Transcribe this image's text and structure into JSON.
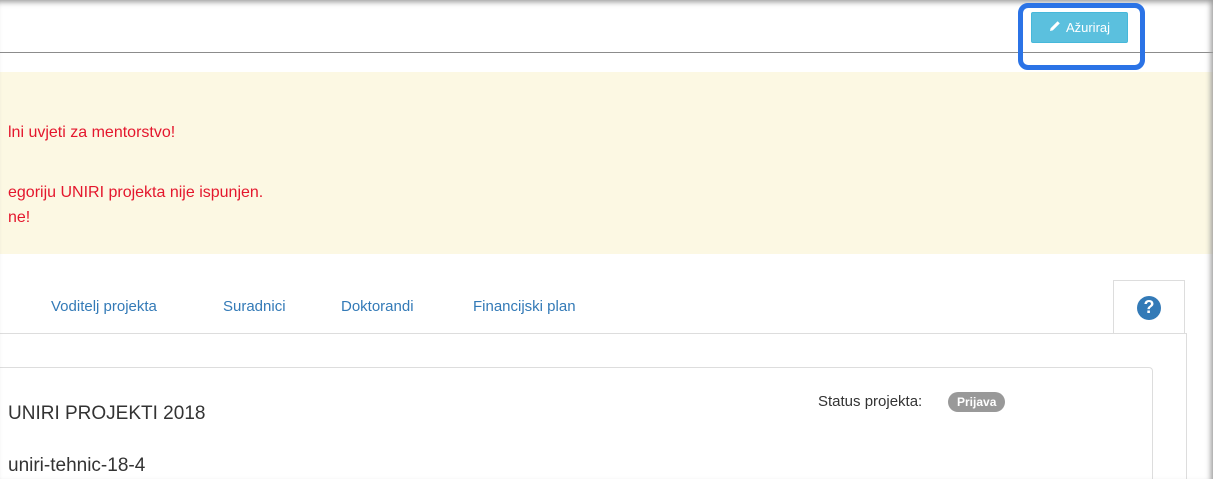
{
  "header": {
    "update_button": "Ažuriraj",
    "update_icon": "pencil-icon"
  },
  "alert": {
    "line1": "lni uvjeti za mentorstvo!",
    "line2": "egoriju UNIRI projekta nije ispunjen.",
    "line3": "ne!"
  },
  "tabs": [
    {
      "label": "Voditelj projekta"
    },
    {
      "label": "Suradnici"
    },
    {
      "label": "Doktorandi"
    },
    {
      "label": "Financijski plan"
    }
  ],
  "help": {
    "icon": "question-circle-icon",
    "glyph": "?"
  },
  "project": {
    "title": "UNIRI PROJEKTI 2018",
    "code": "uniri-tehnic-18-4",
    "status_label": "Status projekta:",
    "status_value": "Prijava"
  },
  "colors": {
    "accent": "#5bc0de",
    "link": "#337ab7",
    "alert_bg": "#fcf8e3",
    "alert_text": "#e4172d",
    "highlight": "#2b73e6"
  }
}
